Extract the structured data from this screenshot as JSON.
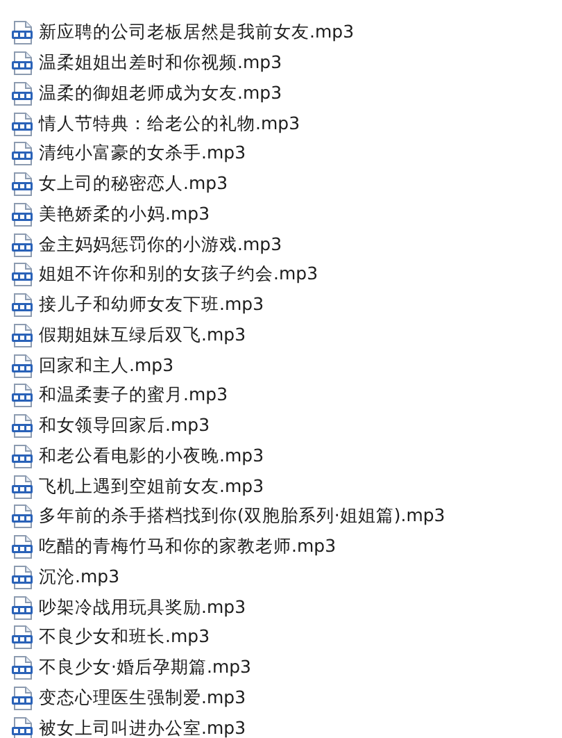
{
  "files": [
    {
      "name": "新应聘的公司老板居然是我前女友.mp3"
    },
    {
      "name": "温柔姐姐出差时和你视频.mp3"
    },
    {
      "name": "温柔的御姐老师成为女友.mp3"
    },
    {
      "name": "情人节特典：给老公的礼物.mp3"
    },
    {
      "name": "清纯小富豪的女杀手.mp3"
    },
    {
      "name": "女上司的秘密恋人.mp3"
    },
    {
      "name": "美艳娇柔的小妈.mp3"
    },
    {
      "name": "金主妈妈惩罚你的小游戏.mp3"
    },
    {
      "name": "姐姐不许你和别的女孩子约会.mp3"
    },
    {
      "name": "接儿子和幼师女友下班.mp3"
    },
    {
      "name": "假期姐妹互绿后双飞.mp3"
    },
    {
      "name": "回家和主人.mp3"
    },
    {
      "name": "和温柔妻子的蜜月.mp3"
    },
    {
      "name": "和女领导回家后.mp3"
    },
    {
      "name": "和老公看电影的小夜晚.mp3"
    },
    {
      "name": "飞机上遇到空姐前女友.mp3"
    },
    {
      "name": "多年前的杀手搭档找到你(双胞胎系列·姐姐篇).mp3"
    },
    {
      "name": "吃醋的青梅竹马和你的家教老师.mp3"
    },
    {
      "name": "沉沦.mp3"
    },
    {
      "name": "吵架冷战用玩具奖励.mp3"
    },
    {
      "name": "不良少女和班长.mp3"
    },
    {
      "name": "不良少女·婚后孕期篇.mp3"
    },
    {
      "name": "变态心理医生强制爱.mp3"
    },
    {
      "name": "被女上司叫进办公室.mp3"
    }
  ]
}
